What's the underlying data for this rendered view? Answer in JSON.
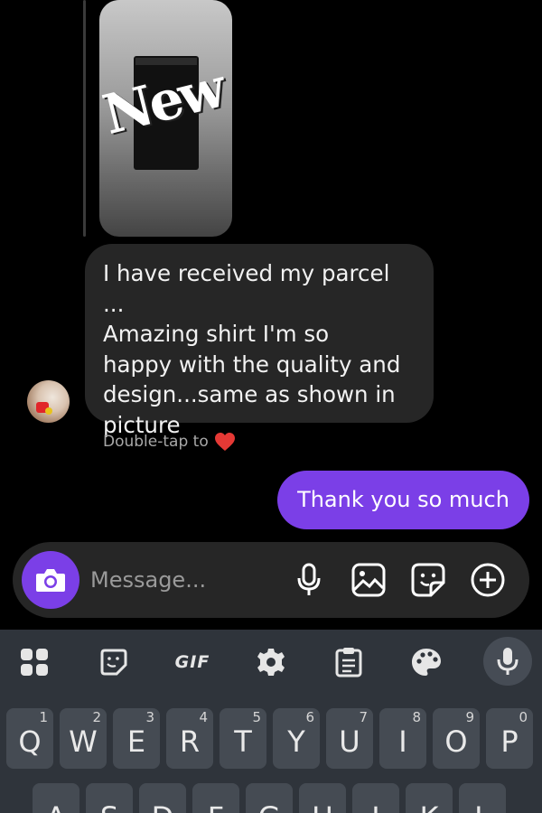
{
  "chat": {
    "received_message": "I have received my parcel ... Amazing shirt I'm so happy with the quality and design...same as shown in picture",
    "received_lines": [
      "I have received my parcel ...",
      "Amazing shirt I'm so",
      "happy with the quality and",
      "design...same as shown in",
      "picture"
    ],
    "double_tap_hint": "Double-tap to",
    "sent_message": "Thank you so much",
    "story_text": "New",
    "colors": {
      "sent_bubble": "#7b3fe7",
      "received_bubble": "#262626",
      "heart": "#e53935"
    }
  },
  "composer": {
    "placeholder": "Message...",
    "icons": [
      "camera-icon",
      "microphone-icon",
      "gallery-icon",
      "sticker-icon",
      "add-circle-icon"
    ]
  },
  "keyboard": {
    "toolbar": {
      "gif_label": "GIF",
      "icons": [
        "apps-grid-icon",
        "sticker-icon",
        "gif-icon",
        "settings-gear-icon",
        "clipboard-icon",
        "palette-icon",
        "microphone-icon"
      ]
    },
    "row1": [
      {
        "letter": "Q",
        "num": "1"
      },
      {
        "letter": "W",
        "num": "2"
      },
      {
        "letter": "E",
        "num": "3"
      },
      {
        "letter": "R",
        "num": "4"
      },
      {
        "letter": "T",
        "num": "5"
      },
      {
        "letter": "Y",
        "num": "6"
      },
      {
        "letter": "U",
        "num": "7"
      },
      {
        "letter": "I",
        "num": "8"
      },
      {
        "letter": "O",
        "num": "9"
      },
      {
        "letter": "P",
        "num": "0"
      }
    ],
    "row2": [
      "A",
      "S",
      "D",
      "F",
      "G",
      "H",
      "J",
      "K",
      "L"
    ]
  }
}
